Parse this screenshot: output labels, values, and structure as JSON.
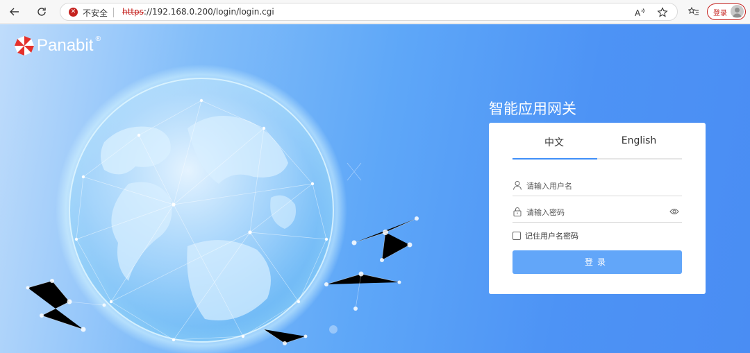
{
  "browser": {
    "security_label": "不安全",
    "url_scheme": "https",
    "url_rest": "://192.168.0.200/login/login.cgi",
    "profile_button_label": "登录"
  },
  "app": {
    "logo_text": "Panabit",
    "logo_reg": "®",
    "product_title": "智能应用网关"
  },
  "login": {
    "tabs": [
      {
        "label": "中文",
        "active": true
      },
      {
        "label": "English",
        "active": false
      }
    ],
    "username_placeholder": "请输入用户名",
    "password_placeholder": "请输入密码",
    "remember_label": "记住用户名密码",
    "submit_label": "登录"
  },
  "colors": {
    "accent": "#3f8ef8",
    "submit": "#62a6f9",
    "insecure": "#c5221f"
  }
}
